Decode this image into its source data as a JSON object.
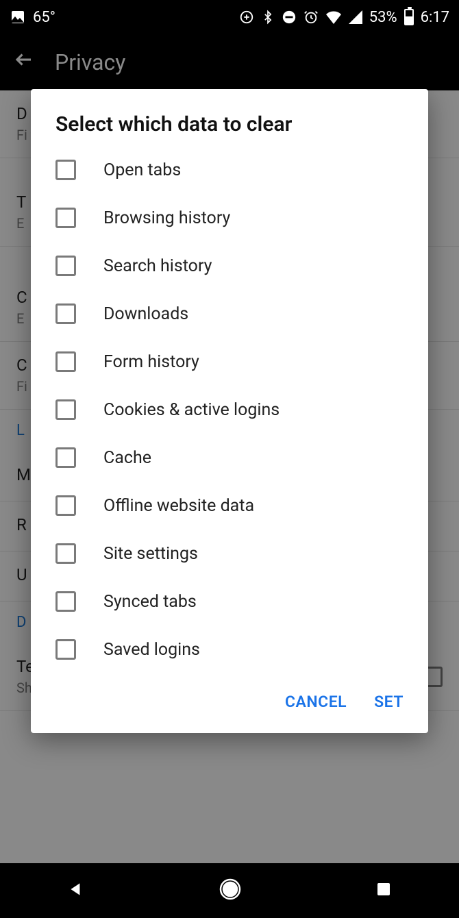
{
  "status": {
    "temperature": "65°",
    "battery_pct": "53%",
    "clock": "6:17"
  },
  "appbar": {
    "title": "Privacy"
  },
  "background": {
    "items": [
      {
        "title": "D",
        "sub": "Fi\ntr"
      },
      {
        "title": "T",
        "sub": "E"
      },
      {
        "title": "C",
        "sub": "E"
      },
      {
        "title": "C",
        "sub": "Fi\nyo"
      }
    ],
    "link1": "L",
    "rows": [
      "M",
      "R",
      "U"
    ],
    "link2": "D",
    "telemetry_title": "Telemetry",
    "telemetry_sub": "Shares performance, usage, hardware and"
  },
  "dialog": {
    "title": "Select which data to clear",
    "options": [
      "Open tabs",
      "Browsing history",
      "Search history",
      "Downloads",
      "Form history",
      "Cookies & active logins",
      "Cache",
      "Offline website data",
      "Site settings",
      "Synced tabs",
      "Saved logins"
    ],
    "cancel": "CANCEL",
    "set": "SET"
  }
}
